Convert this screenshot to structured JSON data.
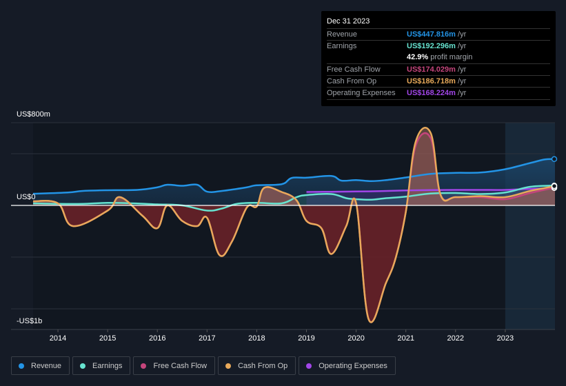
{
  "tooltip": {
    "date": "Dec 31 2023",
    "rows": [
      {
        "label": "Revenue",
        "value": "US$447.816m",
        "unit": "/yr",
        "color": "#2394e6"
      },
      {
        "label": "Earnings",
        "value": "US$192.296m",
        "unit": "/yr",
        "color": "#67e3d0"
      },
      {
        "label": "Free Cash Flow",
        "value": "US$174.029m",
        "unit": "/yr",
        "color": "#c5457c"
      },
      {
        "label": "Cash From Op",
        "value": "US$186.718m",
        "unit": "/yr",
        "color": "#e8a95a"
      },
      {
        "label": "Operating Expenses",
        "value": "US$168.224m",
        "unit": "/yr",
        "color": "#a146e8"
      }
    ],
    "margin_value": "42.9%",
    "margin_label": "profit margin"
  },
  "legend": [
    {
      "label": "Revenue",
      "color": "#2394e6"
    },
    {
      "label": "Earnings",
      "color": "#67e3d0"
    },
    {
      "label": "Free Cash Flow",
      "color": "#c5457c"
    },
    {
      "label": "Cash From Op",
      "color": "#e8a95a"
    },
    {
      "label": "Operating Expenses",
      "color": "#a146e8"
    }
  ],
  "chart_data": {
    "type": "line",
    "title": "",
    "xlabel": "",
    "ylabel": "",
    "x_range": [
      2013.5,
      2024.0
    ],
    "ylim": [
      -1200,
      800
    ],
    "y_unit": "US$ millions",
    "y_tick_labels": [
      {
        "value": 800,
        "label": "US$800m"
      },
      {
        "value": 0,
        "label": "US$0"
      },
      {
        "value": -1000,
        "label": "-US$1b"
      }
    ],
    "y_gridlines": [
      800,
      500,
      0,
      -500,
      -1000
    ],
    "x_ticks": [
      2014,
      2015,
      2016,
      2017,
      2018,
      2019,
      2020,
      2021,
      2022,
      2023
    ],
    "forecast_shade_start": 2023.0,
    "series": [
      {
        "name": "Revenue",
        "color": "#2394e6",
        "x": [
          2013.5,
          2014.2,
          2014.5,
          2015.0,
          2015.6,
          2016.0,
          2016.2,
          2016.5,
          2016.8,
          2017.0,
          2017.3,
          2017.8,
          2018.0,
          2018.5,
          2018.7,
          2019.0,
          2019.5,
          2019.7,
          2020.0,
          2020.3,
          2020.6,
          2021.0,
          2021.5,
          2022.0,
          2022.5,
          2023.0,
          2023.5,
          2023.8,
          2024.0
        ],
        "values": [
          113,
          125,
          140,
          147,
          150,
          175,
          200,
          190,
          200,
          133,
          140,
          175,
          195,
          205,
          265,
          268,
          285,
          240,
          245,
          235,
          245,
          270,
          305,
          315,
          318,
          350,
          410,
          445,
          448
        ]
      },
      {
        "name": "Earnings",
        "color": "#67e3d0",
        "x": [
          2013.5,
          2014.0,
          2014.5,
          2015.0,
          2015.5,
          2016.0,
          2016.5,
          2017.0,
          2017.3,
          2017.6,
          2018.0,
          2018.5,
          2018.8,
          2019.0,
          2019.5,
          2019.8,
          2020.0,
          2020.3,
          2020.6,
          2021.0,
          2021.5,
          2022.0,
          2022.5,
          2023.0,
          2023.5,
          2024.0
        ],
        "values": [
          20,
          15,
          15,
          25,
          20,
          10,
          0,
          -50,
          -30,
          15,
          25,
          20,
          80,
          100,
          110,
          70,
          60,
          55,
          70,
          85,
          115,
          120,
          110,
          125,
          180,
          192
        ]
      },
      {
        "name": "Free Cash Flow",
        "color": "#c5457c",
        "x": [
          2013.5,
          2014.0,
          2014.3,
          2015.0,
          2015.25,
          2015.7,
          2016.0,
          2016.2,
          2016.5,
          2016.8,
          2017.0,
          2017.25,
          2017.5,
          2017.8,
          2018.0,
          2018.15,
          2018.5,
          2018.8,
          2019.0,
          2019.3,
          2019.5,
          2019.8,
          2020.0,
          2020.25,
          2020.6,
          2020.8,
          2021.0,
          2021.2,
          2021.5,
          2021.7,
          2022.0,
          2022.5,
          2023.0,
          2023.5,
          2024.0
        ],
        "values": [
          40,
          20,
          -200,
          -50,
          80,
          -100,
          -220,
          0,
          -150,
          -200,
          -120,
          -480,
          -350,
          -20,
          -10,
          170,
          130,
          50,
          -150,
          -220,
          -470,
          -200,
          20,
          -1100,
          -750,
          -500,
          -60,
          580,
          650,
          100,
          80,
          80,
          60,
          120,
          174
        ]
      },
      {
        "name": "Cash From Op",
        "color": "#e8a95a",
        "x": [
          2013.5,
          2014.0,
          2014.3,
          2015.0,
          2015.25,
          2015.7,
          2016.0,
          2016.2,
          2016.5,
          2016.8,
          2017.0,
          2017.25,
          2017.5,
          2017.8,
          2018.0,
          2018.15,
          2018.5,
          2018.8,
          2019.0,
          2019.3,
          2019.5,
          2019.8,
          2020.0,
          2020.25,
          2020.6,
          2020.8,
          2021.0,
          2021.2,
          2021.5,
          2021.7,
          2022.0,
          2022.5,
          2023.0,
          2023.5,
          2024.0
        ],
        "values": [
          40,
          20,
          -200,
          -50,
          80,
          -100,
          -220,
          0,
          -150,
          -200,
          -120,
          -480,
          -350,
          -20,
          -10,
          170,
          130,
          50,
          -150,
          -220,
          -470,
          -200,
          20,
          -1100,
          -750,
          -500,
          -60,
          620,
          700,
          100,
          80,
          90,
          80,
          140,
          187
        ]
      },
      {
        "name": "Operating Expenses",
        "color": "#a146e8",
        "x": [
          2019.0,
          2019.5,
          2020.0,
          2020.5,
          2021.0,
          2021.5,
          2022.0,
          2022.5,
          2023.0,
          2023.5,
          2024.0
        ],
        "values": [
          130,
          132,
          135,
          138,
          145,
          148,
          150,
          150,
          150,
          160,
          168
        ]
      }
    ]
  }
}
